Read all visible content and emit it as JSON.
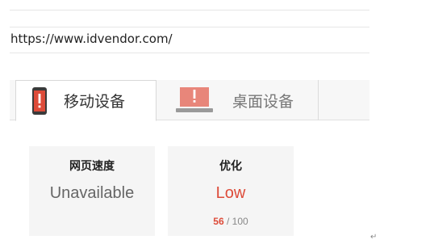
{
  "url": "https://www.idvendor.com/",
  "tabs": [
    {
      "label": "移动设备",
      "icon": "mobile-phone-alert-icon",
      "active": true
    },
    {
      "label": "桌面设备",
      "icon": "desktop-alert-icon",
      "active": false
    }
  ],
  "cards": {
    "speed": {
      "title": "网页速度",
      "value": "Unavailable"
    },
    "optimization": {
      "title": "优化",
      "value": "Low",
      "score": "56",
      "score_sep": " / ",
      "score_max": "100"
    }
  },
  "colors": {
    "alert": "#dd4b39",
    "tab_bg": "#f7f7f7",
    "card_bg": "#f5f5f5"
  },
  "paragraph_mark": "↵"
}
